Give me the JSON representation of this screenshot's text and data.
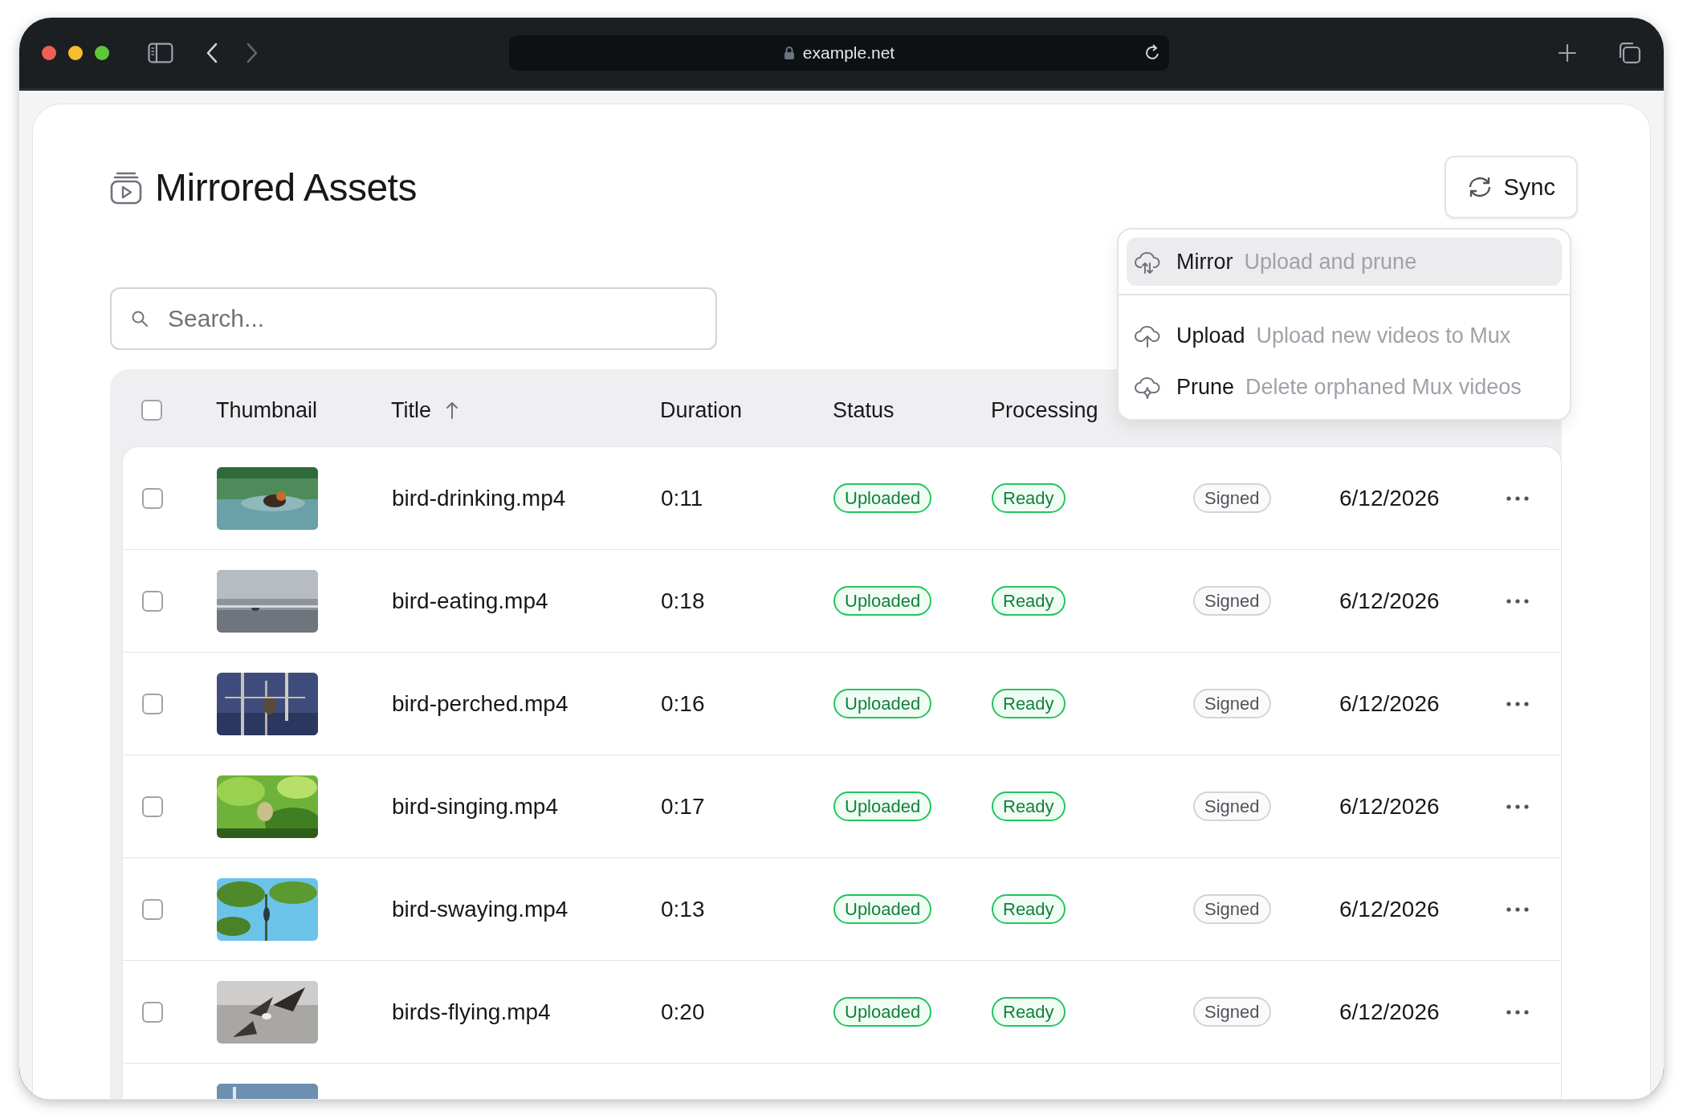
{
  "browser": {
    "url": "example.net",
    "nav": [
      {
        "kind": "back",
        "disabled": false
      },
      {
        "kind": "forward",
        "disabled": true
      }
    ]
  },
  "page": {
    "title": "Mirrored Assets",
    "sync_button": "Sync",
    "sync_menu": [
      {
        "kind": "mirror",
        "label": "Mirror",
        "description": "Upload and prune",
        "selected": true,
        "divider_after": true
      },
      {
        "kind": "upload",
        "label": "Upload",
        "description": "Upload new videos to Mux",
        "selected": false,
        "divider_after": false
      },
      {
        "kind": "prune",
        "label": "Prune",
        "description": "Delete orphaned Mux videos",
        "selected": false,
        "divider_after": false
      }
    ],
    "search": {
      "placeholder": "Search..."
    },
    "table": {
      "select_all": {
        "checked": false
      },
      "columns": [
        {
          "label": "Thumbnail",
          "sorted": false
        },
        {
          "label": "Title",
          "sorted": true
        },
        {
          "label": "Duration",
          "sorted": false
        },
        {
          "label": "Status",
          "sorted": false
        },
        {
          "label": "Processing",
          "sorted": false
        }
      ],
      "rows": [
        {
          "kind": "full",
          "checked": false,
          "title": "bird-drinking.mp4",
          "duration": "0:11",
          "status": "Uploaded",
          "processing": "Ready",
          "policy": "Signed",
          "created": "6/12/2026"
        },
        {
          "kind": "full",
          "checked": false,
          "title": "bird-eating.mp4",
          "duration": "0:18",
          "status": "Uploaded",
          "processing": "Ready",
          "policy": "Signed",
          "created": "6/12/2026"
        },
        {
          "kind": "full",
          "checked": false,
          "title": "bird-perched.mp4",
          "duration": "0:16",
          "status": "Uploaded",
          "processing": "Ready",
          "policy": "Signed",
          "created": "6/12/2026"
        },
        {
          "kind": "full",
          "checked": false,
          "title": "bird-singing.mp4",
          "duration": "0:17",
          "status": "Uploaded",
          "processing": "Ready",
          "policy": "Signed",
          "created": "6/12/2026"
        },
        {
          "kind": "full",
          "checked": false,
          "title": "bird-swaying.mp4",
          "duration": "0:13",
          "status": "Uploaded",
          "processing": "Ready",
          "policy": "Signed",
          "created": "6/12/2026"
        },
        {
          "kind": "full",
          "checked": false,
          "title": "birds-flying.mp4",
          "duration": "0:20",
          "status": "Uploaded",
          "processing": "Ready",
          "policy": "Signed",
          "created": "6/12/2026"
        },
        {
          "kind": "cut"
        }
      ]
    }
  }
}
